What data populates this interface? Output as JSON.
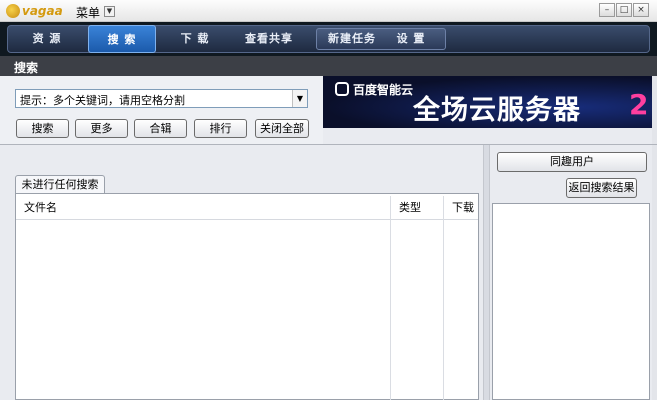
{
  "titlebar": {
    "app_name": "vagaa",
    "menu_label": "菜单",
    "menu_arrow": "▼",
    "minimize": "–",
    "maximize": "□",
    "close": "×"
  },
  "nav": {
    "tabs": [
      {
        "label": "资 源",
        "active": false
      },
      {
        "label": "搜 索",
        "active": true
      },
      {
        "label": "下 载",
        "active": false
      },
      {
        "label": "查看共享",
        "active": false
      },
      {
        "label": "新建任务",
        "active": false
      },
      {
        "label": "设 置",
        "active": false
      }
    ]
  },
  "search": {
    "header": "搜索",
    "input_value": "提示：多个关键词，请用空格分割",
    "dropdown_arrow": "▼",
    "buttons": [
      "搜索",
      "更多",
      "合辑",
      "排行",
      "关闭全部"
    ]
  },
  "banner": {
    "logo_text": "百度智能云",
    "main_text": "全场云服务器",
    "number": "2"
  },
  "results": {
    "tab_label": "未进行任何搜索",
    "columns": [
      "文件名",
      "类型",
      "下载"
    ]
  },
  "right_panel": {
    "users_button": "同趣用户",
    "back_button": "返回搜索结果"
  }
}
